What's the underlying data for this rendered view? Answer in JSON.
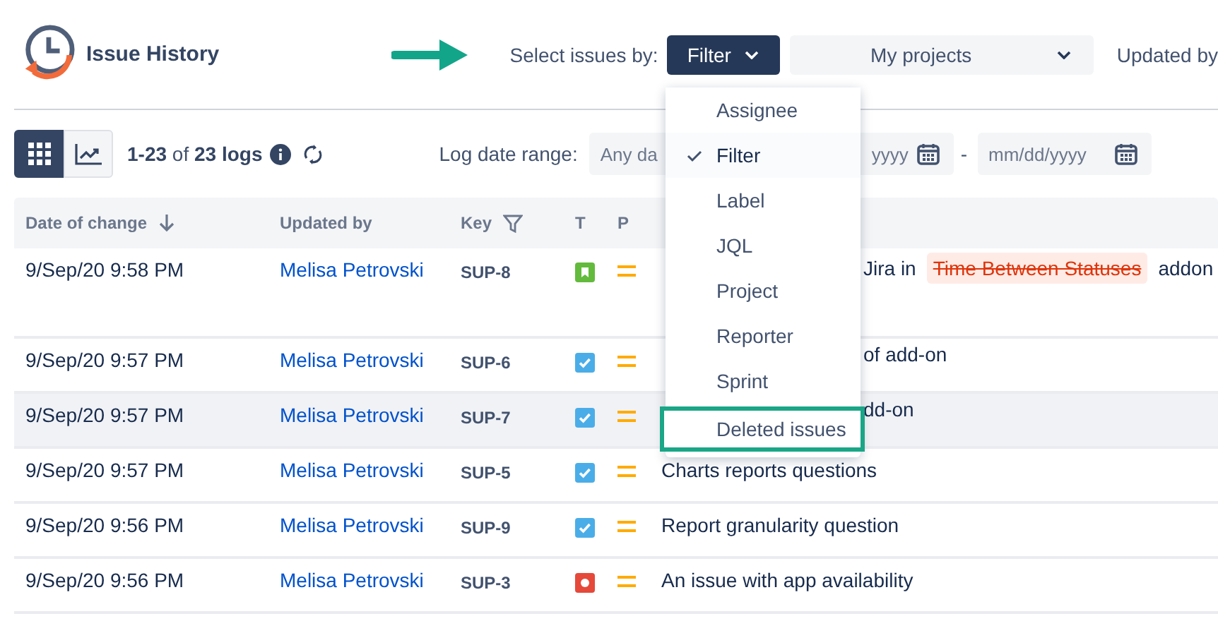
{
  "app": {
    "title": "Issue History"
  },
  "selector": {
    "label": "Select issues by:",
    "mode": "Filter",
    "project": "My projects",
    "next_label": "Updated by"
  },
  "toolbar": {
    "views": [
      {
        "kind": "grid",
        "selected": true
      },
      {
        "kind": "chart",
        "selected": false
      }
    ],
    "count": "**1-23** of **23 logs**",
    "range_label": "Log date range:",
    "from_left": "Any da",
    "from_right": "yyyy",
    "separator": "-",
    "to_placeholder": "mm/dd/yyyy"
  },
  "table": {
    "columns": [
      {
        "label": "Date of change",
        "kind": "sort"
      },
      {
        "label": "Updated by",
        "kind": "plain"
      },
      {
        "label": "Key",
        "kind": "filter"
      },
      {
        "label": "T",
        "kind": "plain"
      },
      {
        "label": "P",
        "kind": "plain"
      }
    ],
    "rows": [
      {
        "date": "9/Sep/20 9:58 PM",
        "user": "Melisa Petrovski",
        "key": "SUP-8",
        "type": {
          "kind": "story"
        },
        "priority": {
          "kind": "medium"
        },
        "selected": false,
        "tall": true,
        "tail": [
          {
            "kind": "text",
            "text": "Jira in"
          },
          {
            "kind": "deleted",
            "text": "Time Between Statuses"
          },
          {
            "kind": "text",
            "text": "addon"
          }
        ]
      },
      {
        "date": "9/Sep/20 9:57 PM",
        "user": "Melisa Petrovski",
        "key": "SUP-6",
        "type": {
          "kind": "task"
        },
        "priority": {
          "kind": "medium"
        },
        "selected": false,
        "tall": false,
        "tail": [
          {
            "kind": "text",
            "text": "of add-on"
          }
        ]
      },
      {
        "date": "9/Sep/20 9:57 PM",
        "user": "Melisa Petrovski",
        "key": "SUP-7",
        "type": {
          "kind": "task"
        },
        "priority": {
          "kind": "medium"
        },
        "selected": true,
        "tall": false,
        "tail": [
          {
            "kind": "text",
            "text": "dd-on"
          }
        ]
      },
      {
        "date": "9/Sep/20 9:57 PM",
        "user": "Melisa Petrovski",
        "key": "SUP-5",
        "type": {
          "kind": "task"
        },
        "priority": {
          "kind": "medium"
        },
        "selected": false,
        "tall": false,
        "lead": "Charts reports questions"
      },
      {
        "date": "9/Sep/20 9:56 PM",
        "user": "Melisa Petrovski",
        "key": "SUP-9",
        "type": {
          "kind": "task"
        },
        "priority": {
          "kind": "medium"
        },
        "selected": false,
        "tall": false,
        "lead": "Report granularity question"
      },
      {
        "date": "9/Sep/20 9:56 PM",
        "user": "Melisa Petrovski",
        "key": "SUP-3",
        "type": {
          "kind": "bug"
        },
        "priority": {
          "kind": "medium"
        },
        "selected": false,
        "tall": false,
        "lead": "An issue with app availability"
      }
    ]
  },
  "menu": {
    "items": [
      {
        "label": "Assignee",
        "selected": false,
        "highlighted": false
      },
      {
        "label": "Filter",
        "selected": true,
        "highlighted": false
      },
      {
        "label": "Label",
        "selected": false,
        "highlighted": false
      },
      {
        "label": "JQL",
        "selected": false,
        "highlighted": false
      },
      {
        "label": "Project",
        "selected": false,
        "highlighted": false
      },
      {
        "label": "Reporter",
        "selected": false,
        "highlighted": false
      },
      {
        "label": "Sprint",
        "selected": false,
        "highlighted": false
      },
      {
        "label": "Deleted issues",
        "selected": false,
        "highlighted": true
      }
    ]
  }
}
